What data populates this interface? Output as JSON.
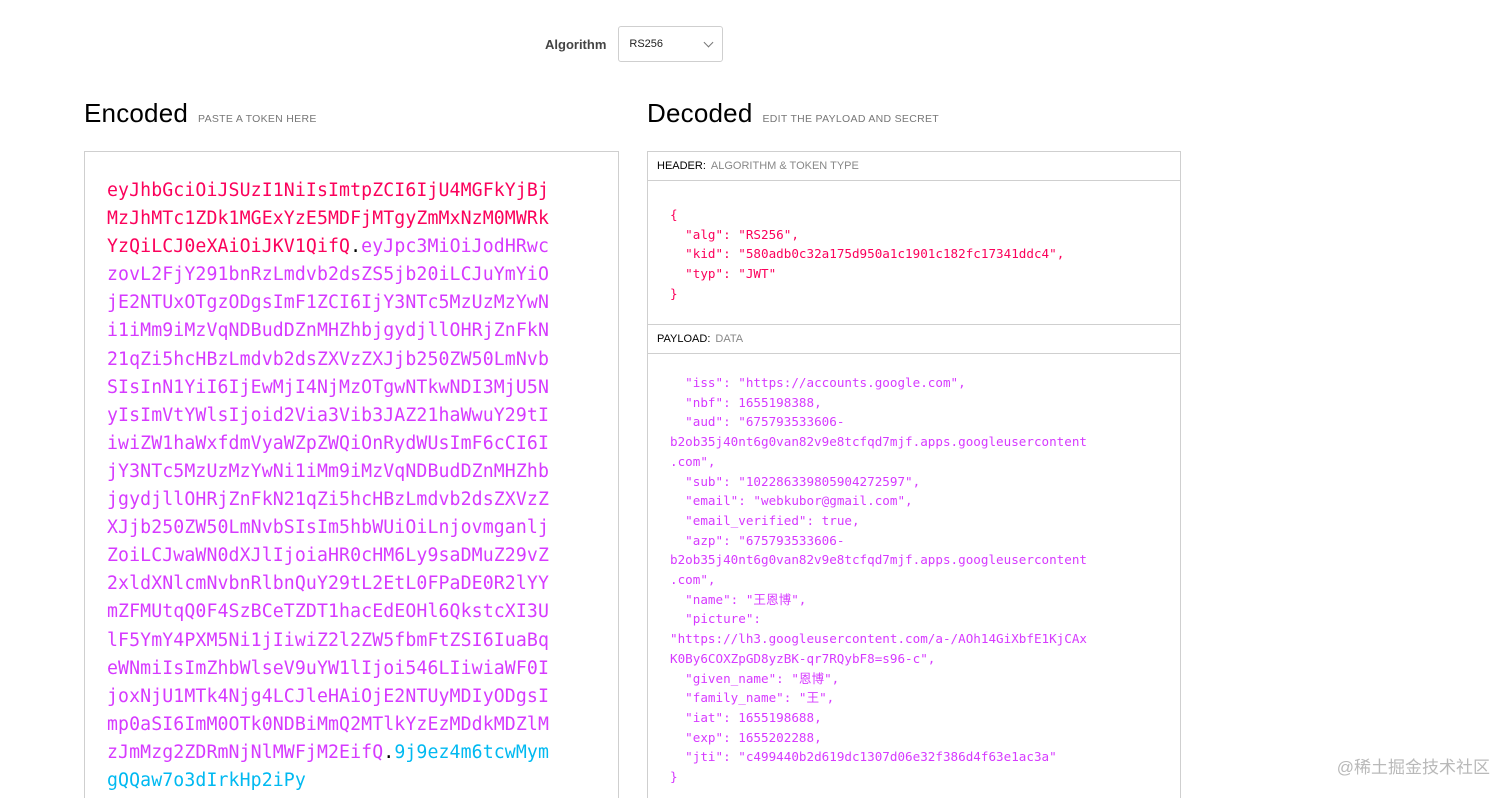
{
  "algorithm": {
    "label": "Algorithm",
    "selected": "RS256"
  },
  "encoded": {
    "title": "Encoded",
    "subtitle": "PASTE A TOKEN HERE",
    "header_part": "eyJhbGciOiJSUzI1NiIsImtpZCI6IjU4MGFkYjBjMzJhMTc1ZDk1MGExYzE5MDFjMTgyZmMxNzM0MWRkYzQiLCJ0eXAiOiJKV1QifQ",
    "dot1": ".",
    "payload_part": "eyJpc3MiOiJodHRwczovL2FjY291bnRzLmdvb2dsZS5jb20iLCJuYmYiOjE2NTUxOTgzODgsImF1ZCI6IjY3NTc5MzUzMzYwNi1iMm9iMzVqNDBudDZnMHZhbjgydjllOHRjZnFkN21qZi5hcHBzLmdvb2dsZXVzZXJjb250ZW50LmNvbSIsInN1YiI6IjEwMjI4NjMzOTgwNTkwNDI3MjU5NyIsImVtYWlsIjoid2Via3Vib3JAZ21haWwuY29tIiwiZW1haWxfdmVyaWZpZWQiOnRydWUsImF6cCI6IjY3NTc5MzUzMzYwNi1iMm9iMzVqNDBudDZnMHZhbjgydjllOHRjZnFkN21qZi5hcHBzLmdvb2dsZXVzZXJjb250ZW50LmNvbSIsIm5hbWUiOiLnjovmganljZoiLCJwaWN0dXJlIjoiaHR0cHM6Ly9saDMuZ29vZ2xldXNlcmNvbnRlbnQuY29tL2EtL0FPaDE0R2lYYmZFMUtqQ0F4SzBCeTZDT1hacEdEOHl6QkstcXI3UlF5YmY4PXM5Ni1jIiwiZ2l2ZW5fbmFtZSI6IuaBqeWNmiIsImZhbWlseV9uYW1lIjoi546LIiwiaWF0IjoxNjU1MTk4Njg4LCJleHAiOjE2NTUyMDIyODgsImp0aSI6ImM0OTk0NDBiMmQ2MTlkYzEzMDdkMDZlMzJmMzg2ZDRmNjNlMWFjM2EifQ",
    "dot2": ".",
    "signature_part": "9j9ez4m6tcwMymgQQaw7o3dIrkHp2iPy"
  },
  "decoded": {
    "title": "Decoded",
    "subtitle": "EDIT THE PAYLOAD AND SECRET",
    "header_box": {
      "key": "HEADER:",
      "desc": "ALGORITHM & TOKEN TYPE",
      "lines": [
        "{",
        "  \"alg\": \"RS256\",",
        "  \"kid\": \"580adb0c32a175d950a1c1901c182fc17341ddc4\",",
        "  \"typ\": \"JWT\"",
        "}"
      ]
    },
    "payload_box": {
      "key": "PAYLOAD:",
      "desc": "DATA",
      "lines": [
        "  \"iss\": \"https://accounts.google.com\",",
        "  \"nbf\": 1655198388,",
        "  \"aud\": \"675793533606-",
        "b2ob35j40nt6g0van82v9e8tcfqd7mjf.apps.googleusercontent",
        ".com\",",
        "  \"sub\": \"102286339805904272597\",",
        "  \"email\": \"webkubor@gmail.com\",",
        "  \"email_verified\": true,",
        "  \"azp\": \"675793533606-",
        "b2ob35j40nt6g0van82v9e8tcfqd7mjf.apps.googleusercontent",
        ".com\",",
        "  \"name\": \"王恩博\",",
        "  \"picture\":",
        "\"https://lh3.googleusercontent.com/a-/AOh14GiXbfE1KjCAx",
        "K0By6COXZpGD8yzBK-qr7RQybF8=s96-c\",",
        "  \"given_name\": \"恩博\",",
        "  \"family_name\": \"王\",",
        "  \"iat\": 1655198688,",
        "  \"exp\": 1655202288,",
        "  \"jti\": \"c499440b2d619dc1307d06e32f386d4f63e1ac3a\"",
        "}"
      ]
    }
  },
  "watermark": "@稀土掘金技术社区",
  "colors": {
    "header": "#fb015b",
    "payload": "#d63aff",
    "signature": "#00b9f1"
  }
}
